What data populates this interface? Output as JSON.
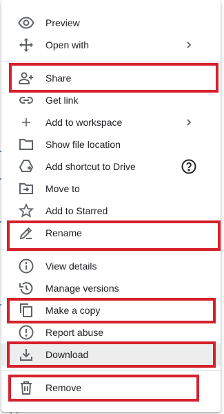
{
  "menu": {
    "items": [
      {
        "label": "Preview",
        "icon": "eye-icon"
      },
      {
        "label": "Open with",
        "icon": "move-arrows-icon",
        "submenu": true
      },
      {
        "label": "Share",
        "icon": "person-add-icon"
      },
      {
        "label": "Get link",
        "icon": "link-icon"
      },
      {
        "label": "Add to workspace",
        "icon": "plus-icon",
        "submenu": true
      },
      {
        "label": "Show file location",
        "icon": "folder-icon"
      },
      {
        "label": "Add shortcut to Drive",
        "icon": "drive-shortcut-icon",
        "help": true
      },
      {
        "label": "Move to",
        "icon": "move-to-folder-icon"
      },
      {
        "label": "Add to Starred",
        "icon": "star-icon"
      },
      {
        "label": "Rename",
        "icon": "pencil-icon"
      },
      {
        "label": "View details",
        "icon": "info-icon"
      },
      {
        "label": "Manage versions",
        "icon": "history-icon"
      },
      {
        "label": "Make a copy",
        "icon": "copy-icon"
      },
      {
        "label": "Report abuse",
        "icon": "report-icon"
      },
      {
        "label": "Download",
        "icon": "download-icon",
        "hovered": true
      },
      {
        "label": "Remove",
        "icon": "trash-icon"
      }
    ]
  },
  "background": {
    "fragment_text": "S (x)"
  },
  "colors": {
    "highlight": "#d6212c",
    "hover": "#ededed",
    "text": "#202124",
    "icon": "#5f6368"
  }
}
